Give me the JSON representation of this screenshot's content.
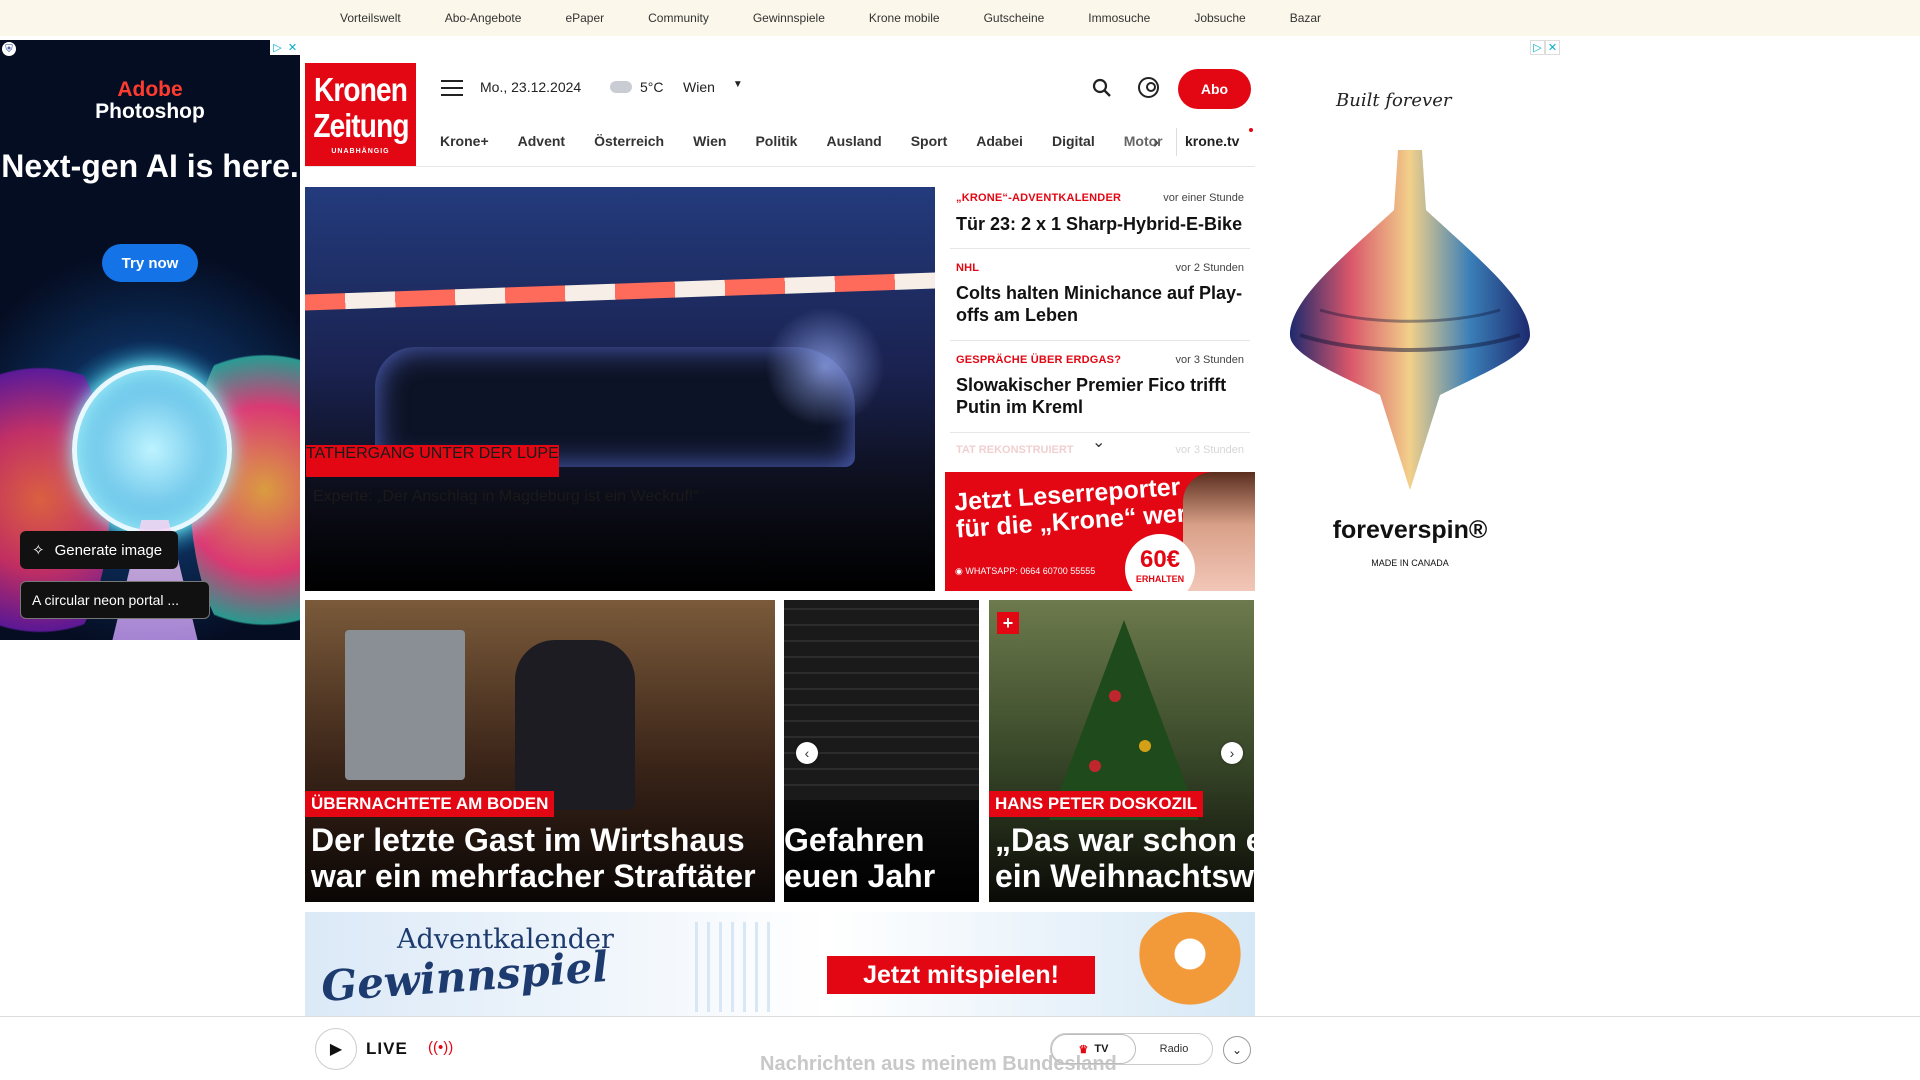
{
  "utility_links": [
    "Vorteilswelt",
    "Abo-Angebote",
    "ePaper",
    "Community",
    "Gewinnspiele",
    "Krone mobile",
    "Gutscheine",
    "Immosuche",
    "Jobsuche",
    "Bazar"
  ],
  "ad_left": {
    "brand_line1": "Adobe",
    "brand_line2": "Photoshop",
    "headline": "Next-gen AI is here.",
    "cta": "Try now",
    "generate_label": "Generate image",
    "prompt_text": "A circular neon portal ..."
  },
  "ad_right": {
    "script": "Built forever",
    "brand": "foreverspin®",
    "made": "MADE IN CANADA"
  },
  "logo": {
    "line1": "Kronen",
    "line2": "Zeitung",
    "line3": "UNABHÄNGIG"
  },
  "header": {
    "date": "Mo., 23.12.2024",
    "temperature": "5°C",
    "city": "Wien",
    "abo_label": "Abo",
    "colors": {
      "brand_red": "#e30613"
    }
  },
  "nav": {
    "items": [
      "Krone+",
      "Advent",
      "Österreich",
      "Wien",
      "Politik",
      "Ausland",
      "Sport",
      "Adabei",
      "Digital",
      "Motor"
    ],
    "tv_label": "krone.tv"
  },
  "hero": {
    "kicker": "TATHERGANG UNTER DER LUPE",
    "title": "Experte: „Der Anschlag in Magdeburg ist ein Weckruf!“"
  },
  "news": [
    {
      "category": "„KRONE“-ADVENTKALENDER",
      "time": "vor einer Stunde",
      "title": "Tür 23: 2 x 1 Sharp-Hybrid-E-Bike"
    },
    {
      "category": "NHL",
      "time": "vor 2 Stunden",
      "title": "Colts halten Minichance auf Play-offs am Leben"
    },
    {
      "category": "GESPRÄCHE ÜBER ERDGAS?",
      "time": "vor 3 Stunden",
      "title": "Slowakischer Premier Fico trifft Putin im Kreml"
    },
    {
      "category": "TAT REKONSTRUIERT",
      "time": "vor 3 Stunden",
      "title": ""
    }
  ],
  "promo": {
    "line1": "Jetzt Leserreporter",
    "line2": "für die „Krone“ werden",
    "whatsapp": "WHATSAPP: 0664 60700 55555",
    "amount": "60€",
    "amount_sub": "ERHALTEN"
  },
  "carousel": [
    {
      "kicker": "ÜBERNACHTETE AM BODEN",
      "title_line1": "Der letzte Gast im Wirtshaus",
      "title_line2": "war ein mehrfacher Straftäter"
    },
    {
      "kicker": "",
      "title_line1": "Gefahren",
      "title_line2": "euen Jahr"
    },
    {
      "kicker": "HANS PETER DOSKOZIL",
      "title_line1": "„Das war schon ei",
      "title_line2": "ein Weihnachtswu"
    }
  ],
  "banner": {
    "line1": "Adventkalender",
    "line2": "Gewinnspiel",
    "cta": "Jetzt mitspielen!"
  },
  "livebar": {
    "live_label": "LIVE",
    "faded_text": "Nachrichten aus meinem Bundesland",
    "tv_label": "TV",
    "radio_label": "Radio"
  }
}
